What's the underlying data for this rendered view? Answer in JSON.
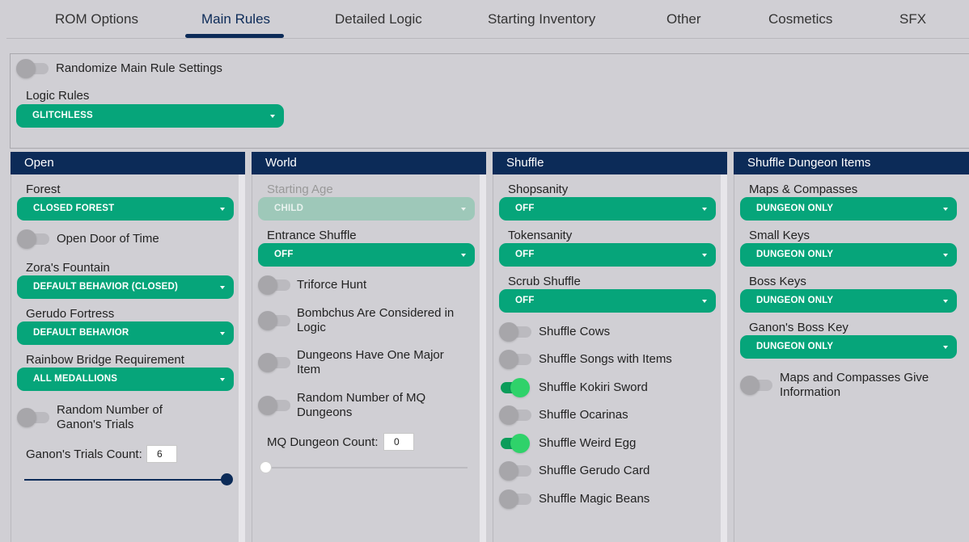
{
  "tabs": [
    "ROM Options",
    "Main Rules",
    "Detailed Logic",
    "Starting Inventory",
    "Other",
    "Cosmetics",
    "SFX"
  ],
  "top": {
    "randomize_label": "Randomize Main Rule Settings",
    "logic_rules_label": "Logic Rules",
    "logic_rules_value": "GLITCHLESS"
  },
  "open": {
    "header": "Open",
    "forest_label": "Forest",
    "forest_value": "CLOSED FOREST",
    "door_label": "Open Door of Time",
    "zora_label": "Zora's Fountain",
    "zora_value": "DEFAULT BEHAVIOR (CLOSED)",
    "gerudo_label": "Gerudo Fortress",
    "gerudo_value": "DEFAULT BEHAVIOR",
    "rainbow_label": "Rainbow Bridge Requirement",
    "rainbow_value": "ALL MEDALLIONS",
    "random_trials_label": "Random Number of Ganon's Trials",
    "trials_count_label": "Ganon's Trials Count:",
    "trials_count_value": "6",
    "trials_slider_fraction": 1.0
  },
  "world": {
    "header": "World",
    "age_label": "Starting Age",
    "age_value": "CHILD",
    "entrance_label": "Entrance Shuffle",
    "entrance_value": "OFF",
    "triforce_label": "Triforce Hunt",
    "bombchus_label": "Bombchus Are Considered in Logic",
    "dungeons_major_label": "Dungeons Have One Major Item",
    "random_mq_label": "Random Number of MQ Dungeons",
    "mq_count_label": "MQ Dungeon Count:",
    "mq_count_value": "0",
    "mq_slider_fraction": 0.0
  },
  "shuffle": {
    "header": "Shuffle",
    "shopsanity_label": "Shopsanity",
    "shopsanity_value": "OFF",
    "tokensanity_label": "Tokensanity",
    "tokensanity_value": "OFF",
    "scrub_label": "Scrub Shuffle",
    "scrub_value": "OFF",
    "cows_label": "Shuffle Cows",
    "songs_label": "Shuffle Songs with Items",
    "kokiri_label": "Shuffle Kokiri Sword",
    "ocarinas_label": "Shuffle Ocarinas",
    "egg_label": "Shuffle Weird Egg",
    "gerudo_card_label": "Shuffle Gerudo Card",
    "beans_label": "Shuffle Magic Beans"
  },
  "dungeon_items": {
    "header": "Shuffle Dungeon Items",
    "maps_label": "Maps & Compasses",
    "maps_value": "DUNGEON ONLY",
    "small_keys_label": "Small Keys",
    "small_keys_value": "DUNGEON ONLY",
    "boss_keys_label": "Boss Keys",
    "boss_keys_value": "DUNGEON ONLY",
    "ganon_key_label": "Ganon's Boss Key",
    "ganon_key_value": "DUNGEON ONLY",
    "maps_info_label": "Maps and Compasses Give Information"
  },
  "colors": {
    "accent_green": "#06a57a",
    "header_navy": "#0c2b58",
    "toggle_on": "#2fd26a"
  }
}
